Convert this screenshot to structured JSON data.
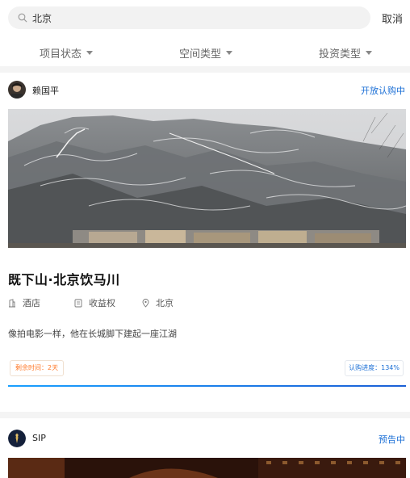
{
  "search": {
    "value": "北京",
    "cancel_label": "取消"
  },
  "filters": [
    {
      "label": "项目状态",
      "icon": "caret-down-icon"
    },
    {
      "label": "空间类型",
      "icon": "caret-down-icon"
    },
    {
      "label": "投资类型",
      "icon": "caret-down-icon"
    }
  ],
  "cards": [
    {
      "author": "赖国平",
      "status": "开放认购中",
      "status_color": "#1b6fd6",
      "title": "既下山·北京饮马川",
      "meta": [
        {
          "icon": "building-icon",
          "label": "酒店"
        },
        {
          "icon": "document-icon",
          "label": "收益权"
        },
        {
          "icon": "location-pin-icon",
          "label": "北京"
        }
      ],
      "description": "像拍电影一样，他在长城脚下建起一座江湖",
      "remaining_label": "剩余时间：2天",
      "progress_label": "认购进度：134%",
      "progress_value": 1.0,
      "remaining_color": "#ff7a2a"
    },
    {
      "author": "SIP",
      "status": "预告中",
      "status_color": "#1b6fd6"
    }
  ]
}
